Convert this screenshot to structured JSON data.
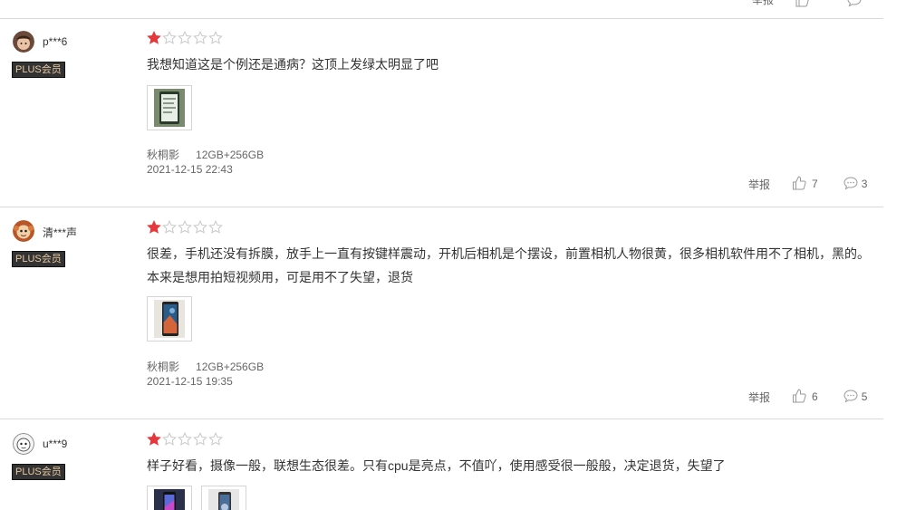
{
  "colors": {
    "star_filled": "#e4393c",
    "star_empty": "#c8c8c8",
    "plus_bg": "#333333",
    "plus_text": "#e8c9a0"
  },
  "plus_label": "PLUS会员",
  "report_label": "举报",
  "reviews": [
    {
      "username": "p***6",
      "rating": 1,
      "text": [
        "我想知道这是个例还是通病？这顶上发绿太明显了吧"
      ],
      "thumbnail_count": 1,
      "color": "秋桐影",
      "storage": "12GB+256GB",
      "time": "2021-12-15 22:43",
      "likes": "7",
      "comments": "3"
    },
    {
      "username": "清***声",
      "rating": 1,
      "text": [
        "很差，手机还没有拆膜，放手上一直有按键样震动，开机后相机是个摆设，前置相机人物很黄，很多相机软件用不了相机，黑的。",
        "本来是想用拍短视频用，可是用不了失望，退货"
      ],
      "thumbnail_count": 1,
      "color": "秋桐影",
      "storage": "12GB+256GB",
      "time": "2021-12-15 19:35",
      "likes": "6",
      "comments": "5"
    },
    {
      "username": "u***9",
      "rating": 1,
      "text": [
        "样子好看，摄像一般，联想生态很差。只有cpu是亮点，不值吖，使用感受很一般般，决定退货，失望了"
      ],
      "thumbnail_count": 2
    }
  ]
}
